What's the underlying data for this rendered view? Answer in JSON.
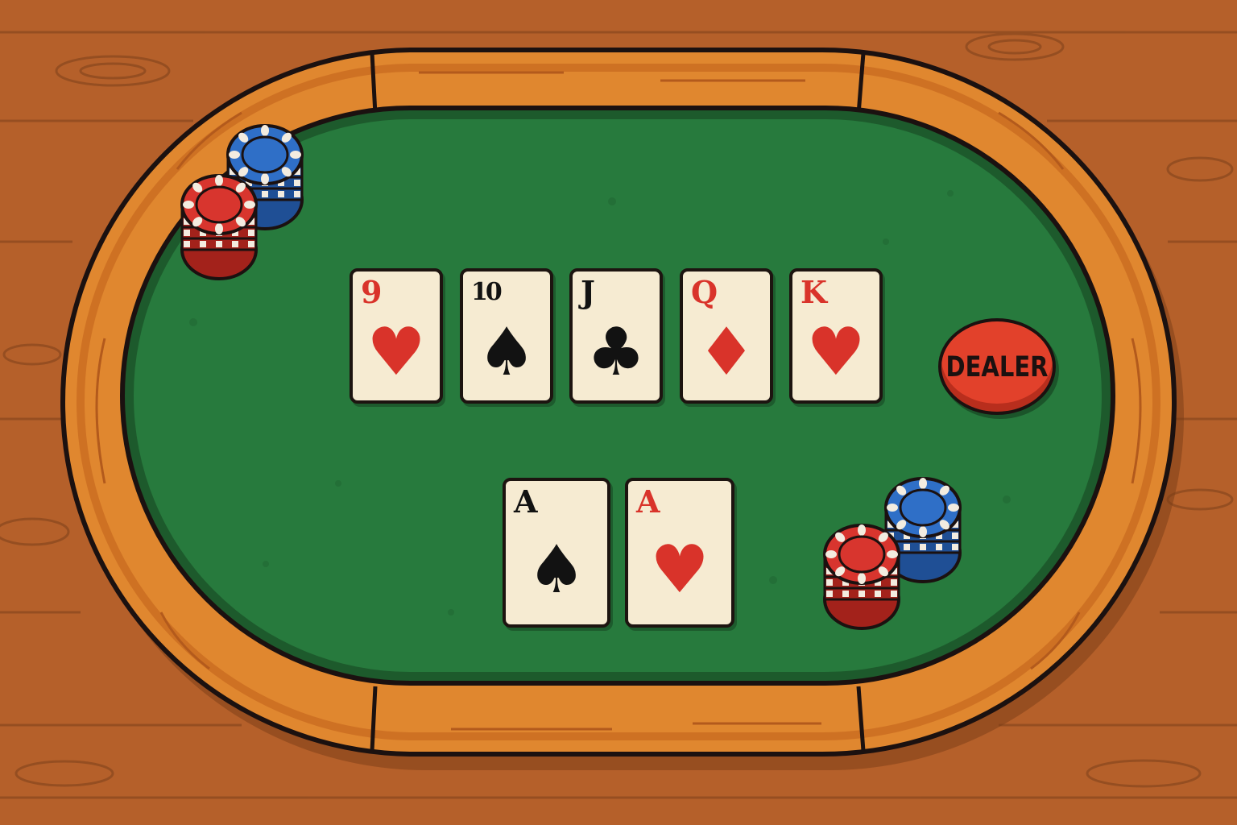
{
  "scene": "poker-table",
  "colors": {
    "floor_wood": "#b5602a",
    "rail_wood": "#e0872f",
    "felt": "#277a3d",
    "card_face": "#f6ebd2",
    "suit_red": "#d9332a",
    "suit_black": "#121212",
    "chip_red": "#d8352e",
    "chip_blue": "#2f6fc7",
    "dealer_button": "#e2412b"
  },
  "community_cards": [
    {
      "rank": "9",
      "suit": "hearts",
      "color": "red"
    },
    {
      "rank": "10",
      "suit": "spades",
      "color": "black"
    },
    {
      "rank": "J",
      "suit": "clubs",
      "color": "black"
    },
    {
      "rank": "Q",
      "suit": "diamonds",
      "color": "red"
    },
    {
      "rank": "K",
      "suit": "hearts",
      "color": "red"
    }
  ],
  "hole_cards": [
    {
      "rank": "A",
      "suit": "spades",
      "color": "black"
    },
    {
      "rank": "A",
      "suit": "hearts",
      "color": "red"
    }
  ],
  "suit_glyphs": {
    "hearts": "♥",
    "spades": "♠",
    "clubs": "♣",
    "diamonds": "♦"
  },
  "dealer_button": {
    "label": "DEALER"
  },
  "chip_stacks": [
    {
      "location": "top-left",
      "color": "blue",
      "chips": 4
    },
    {
      "location": "top-left",
      "color": "red",
      "chips": 4
    },
    {
      "location": "bottom-right",
      "color": "blue",
      "chips": 4
    },
    {
      "location": "bottom-right",
      "color": "red",
      "chips": 4
    }
  ]
}
